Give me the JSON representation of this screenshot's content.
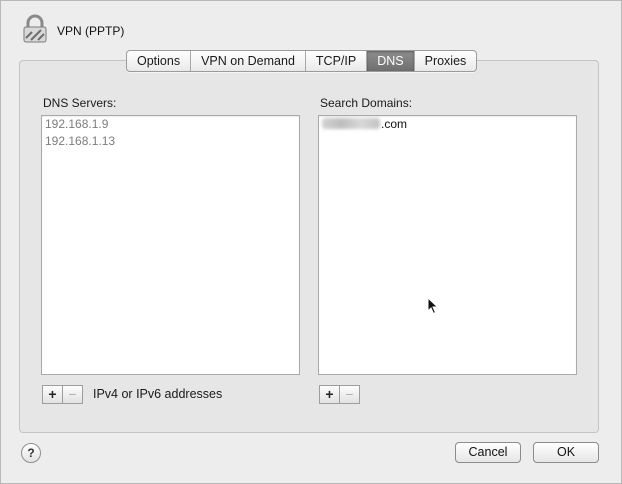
{
  "window": {
    "title": "VPN (PPTP)"
  },
  "tabs": [
    {
      "label": "Options",
      "active": false
    },
    {
      "label": "VPN on Demand",
      "active": false
    },
    {
      "label": "TCP/IP",
      "active": false
    },
    {
      "label": "DNS",
      "active": true
    },
    {
      "label": "Proxies",
      "active": false
    }
  ],
  "dns": {
    "label": "DNS Servers:",
    "servers": [
      "192.168.1.9",
      "192.168.1.13"
    ],
    "hint": "IPv4 or IPv6 addresses"
  },
  "search": {
    "label": "Search Domains:",
    "domains": [
      ".com"
    ]
  },
  "controls": {
    "add": "+",
    "remove": "−"
  },
  "buttons": {
    "help": "?",
    "cancel": "Cancel",
    "ok": "OK"
  }
}
